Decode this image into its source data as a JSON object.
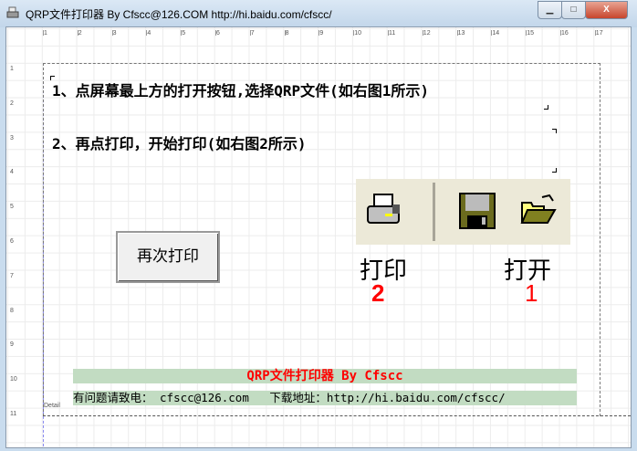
{
  "window": {
    "title": "QRP文件打印器 By Cfscc@126.COM  http://hi.baidu.com/cfscc/",
    "minimize": "▁",
    "maximize": "□",
    "close": "X"
  },
  "ruler": {
    "top": [
      "1",
      "2",
      "3",
      "4",
      "5",
      "6",
      "7",
      "8",
      "9",
      "10",
      "11",
      "12",
      "13",
      "14",
      "15",
      "16",
      "17"
    ],
    "left": [
      "1",
      "2",
      "3",
      "4",
      "5",
      "6",
      "7",
      "8",
      "9",
      "10",
      "11"
    ]
  },
  "instructions": {
    "step1": "1、点屏幕最上方的打开按钮,选择QRP文件(如右图1所示)",
    "step2": "2、再点打印，开始打印(如右图2所示)"
  },
  "reprint_button": "再次打印",
  "toolbar_hint": {
    "print_label": "打印",
    "print_num": "2",
    "open_label": "打开",
    "open_num": "1"
  },
  "footer": {
    "title": "QRP文件打印器 By Cfscc",
    "contact": "有问题请致电： cfscc@126.com   下载地址：http://hi.baidu.com/cfscc/",
    "band_name": "Detail"
  }
}
